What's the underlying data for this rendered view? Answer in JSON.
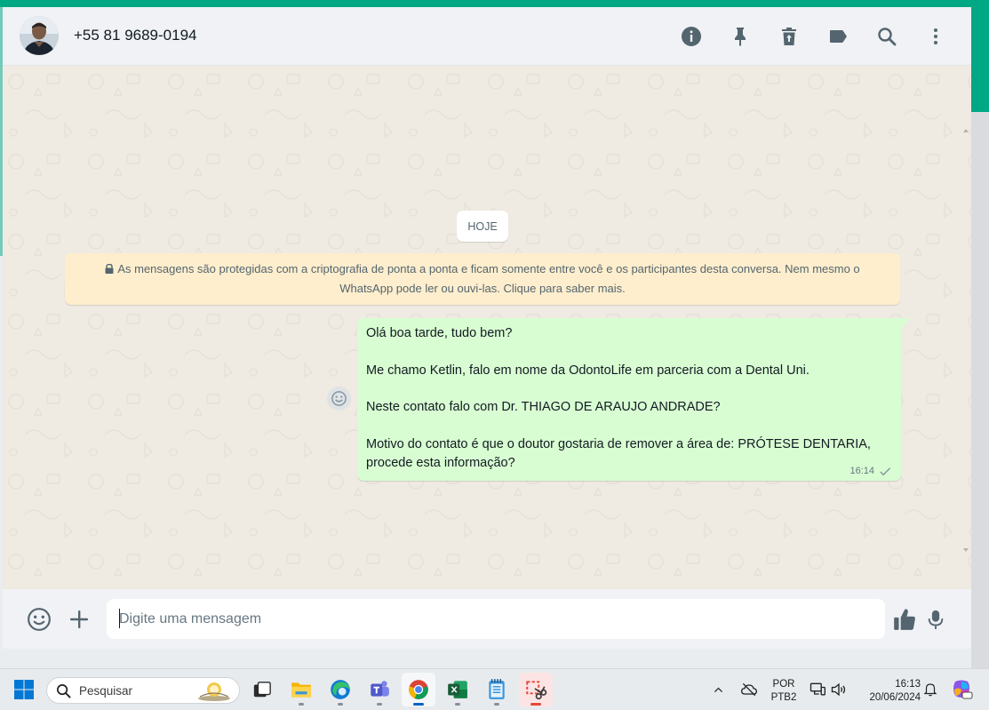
{
  "header": {
    "contact": "+55 81 9689-0194",
    "icons": [
      "info-icon",
      "pin-icon",
      "delete-icon",
      "label-icon",
      "search-icon",
      "menu-icon"
    ]
  },
  "chat": {
    "date_chip": "HOJE",
    "encryption_notice": "As mensagens são protegidas com a criptografia de ponta a ponta e ficam somente entre você e os participantes desta conversa. Nem mesmo o WhatsApp pode ler ou ouvi-las. Clique para saber mais.",
    "message": {
      "text": "Olá boa tarde, tudo bem?\n\nMe chamo Ketlin, falo em nome da OdontoLife em parceria com a Dental Uni.\n\nNeste contato falo com Dr. THIAGO DE ARAUJO ANDRADE?\n\nMotivo do contato é que o doutor gostaria de remover a área de: PRÓTESE DENTARIA, procede esta informação?",
      "time": "16:14",
      "status": "sent"
    }
  },
  "footer": {
    "placeholder": "Digite uma mensagem"
  },
  "taskbar": {
    "search_label": "Pesquisar",
    "language": "POR",
    "layout": "PTB2",
    "time": "16:13",
    "date": "20/06/2024"
  },
  "colors": {
    "accent": "#00a884",
    "outgoing_bubble": "#d9fdd3",
    "notice": "#ffeecd",
    "chat_background": "#efeae2"
  }
}
